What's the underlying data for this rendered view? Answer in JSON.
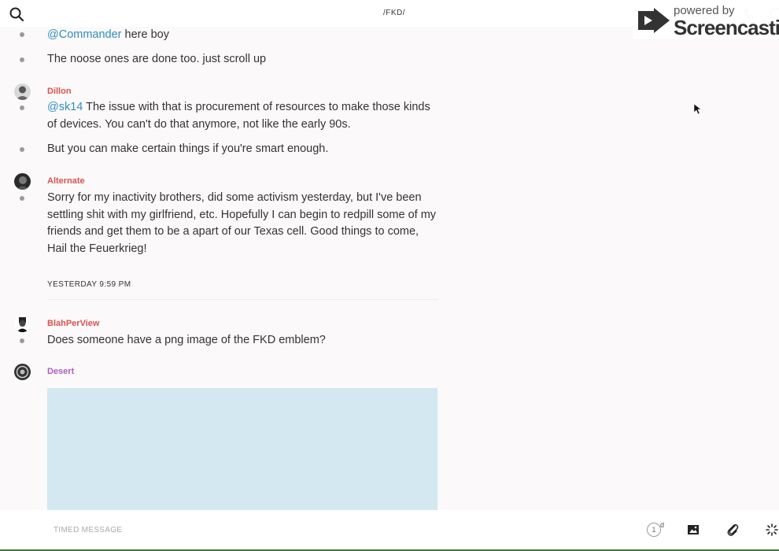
{
  "header": {
    "title": "/FKD/",
    "search_icon": "search-icon",
    "phone_icon": "phone-icon",
    "info_icon": "info-icon"
  },
  "watermark": {
    "powered_by": "powered by",
    "brand": "Screencastify"
  },
  "colors": {
    "mention": "#2e8fbf",
    "user_red": "#d9534f",
    "user_purple": "#b05cc8",
    "image_placeholder": "#d3e8f0"
  },
  "messages": [
    {
      "mention": "@Commander",
      "text": " here boy"
    },
    {
      "text": "The noose ones are done too. just scroll up"
    },
    {
      "user": "Dillon",
      "mention": "@sk14",
      "text": " The issue with that is procurement of resources to make those kinds of devices. You can't do that anymore, not like the early 90s."
    },
    {
      "text": "But you can make certain things if you're smart enough."
    },
    {
      "user": "Alternate",
      "text": "Sorry for my inactivity brothers, did some activism yesterday, but I've been settling shit with my girlfriend, etc. Hopefully I can begin to redpill some of my friends and get them to be a apart of our Texas cell. Good things to come, Hail the Feuerkrieg!"
    },
    {
      "user": "BlahPerView",
      "text": "Does someone have a png image of the FKD emblem?"
    },
    {
      "user": "Desert"
    }
  ],
  "date_separator": "YESTERDAY 9:59 PM",
  "composer": {
    "placeholder": "TIMED MESSAGE",
    "timer_value": "1",
    "timer_unit": "d",
    "image_icon": "image-icon",
    "attach_icon": "paperclip-icon",
    "sparkle_icon": "sparkle-icon"
  }
}
